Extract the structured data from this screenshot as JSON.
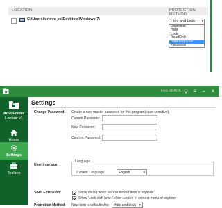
{
  "list": {
    "col_location": "LOCATION",
    "col_method": "PROTECTION METHOD",
    "row_path": "C:\\Users\\lenovo pc\\Desktop\\Windows 7\\",
    "method_selected": "Hide and Lock",
    "method_options": [
      "Unprotect",
      "Hide",
      "Lock",
      "ReadOnly",
      "Hide and Lock",
      "Password"
    ],
    "highlighted_option": "Hide and Lock"
  },
  "window": {
    "feedback": "FEEDBACK",
    "title_color": "#2f8c3e",
    "sidebar_color": "#11612b",
    "active_color": "#3da94e"
  },
  "sidebar": {
    "app_name": "Anvi Folder",
    "app_name2": "Locker",
    "app_version": "v1",
    "items": [
      {
        "label": "Home",
        "icon": "home-icon"
      },
      {
        "label": "Settings",
        "icon": "gear-icon",
        "active": true
      },
      {
        "label": "Toolbox",
        "icon": "toolbox-icon"
      }
    ]
  },
  "settings": {
    "title": "Settings",
    "change_password": {
      "label": "Change Password:",
      "desc": "Create a new master password for this program(case sensitive).",
      "current": "Current Password:",
      "new": "New Password:",
      "confirm": "Confirm Password:"
    },
    "user_interface": {
      "label": "User Interface:",
      "group": "Language",
      "current_language_label": "Current Language",
      "current_language": "English"
    },
    "shell_extension": {
      "label": "Shell Extension:",
      "opt1": "Show dialog when access locked item in explorer",
      "opt2": "Show 'Lock with Anvi Folder Locker' in context menu of explorer"
    },
    "protection_method": {
      "label": "Protection Method:",
      "desc": "New item is defaulted to:",
      "value": "Hide and Lock"
    }
  }
}
